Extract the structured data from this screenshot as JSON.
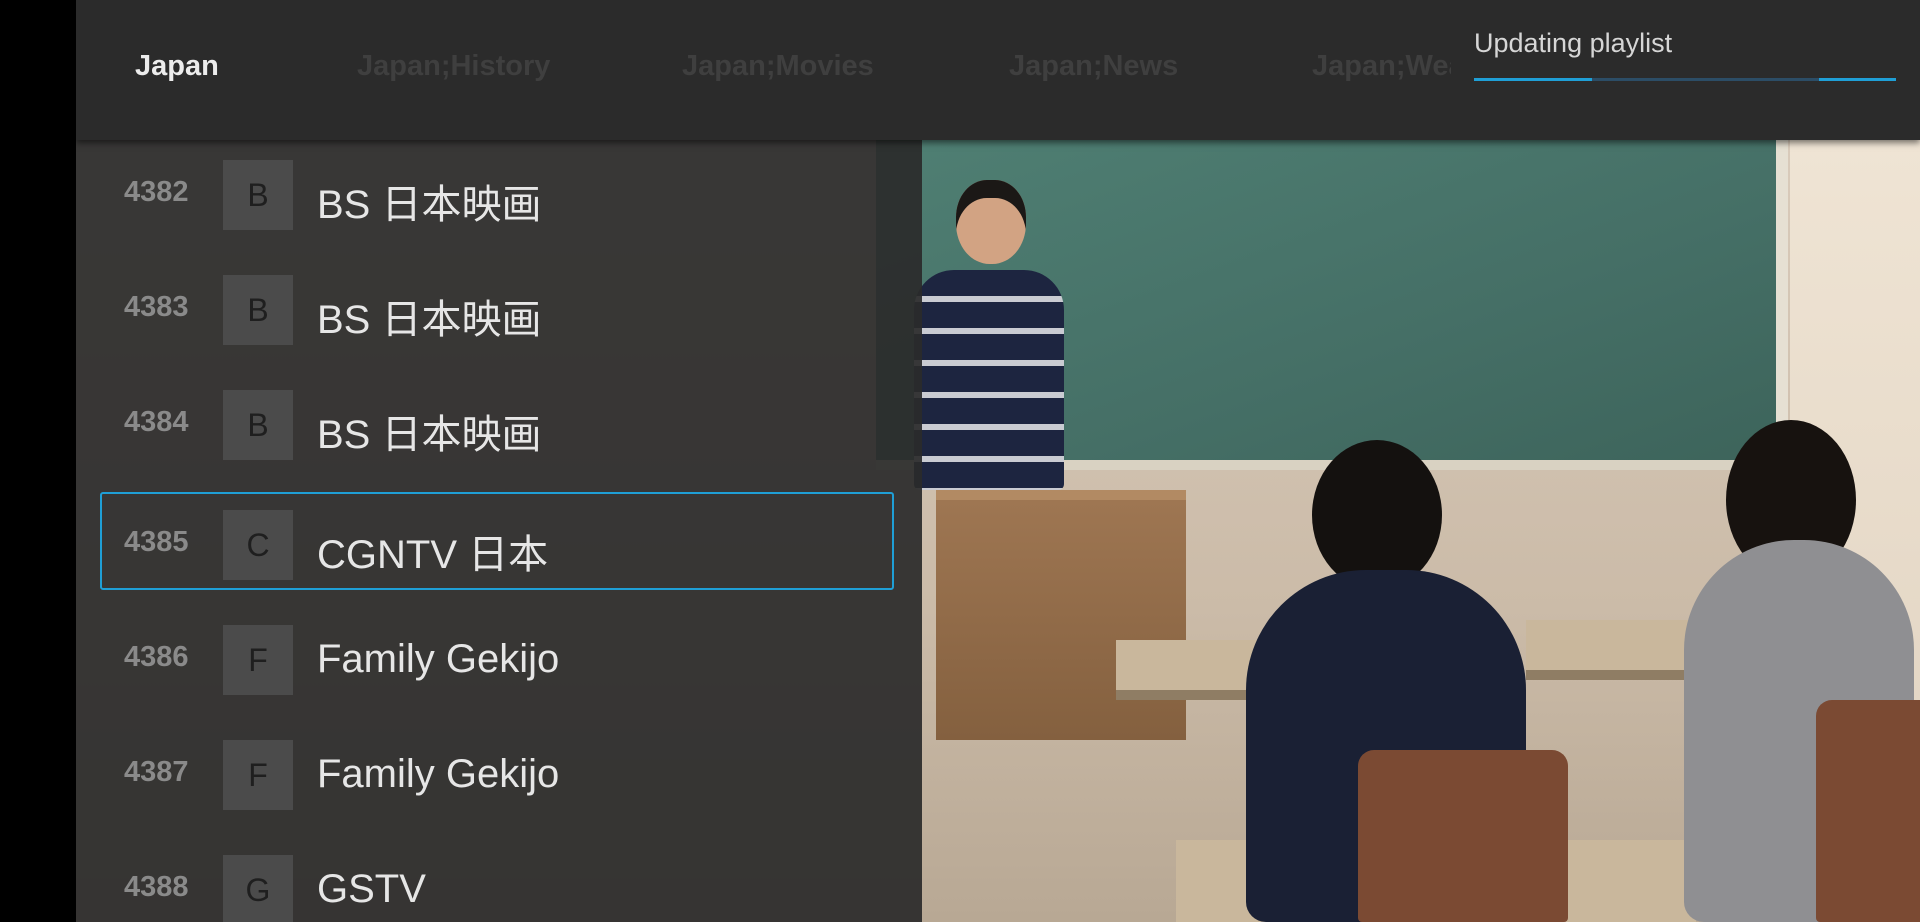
{
  "tabs": [
    {
      "label": "Japan",
      "active": true
    },
    {
      "label": "Japan;History",
      "active": false
    },
    {
      "label": "Japan;Movies",
      "active": false
    },
    {
      "label": "Japan;News",
      "active": false
    },
    {
      "label": "Japan;Wea",
      "active": false
    }
  ],
  "status": {
    "text": "Updating playlist"
  },
  "channels": [
    {
      "number": "4382",
      "letter": "B",
      "name": "BS 日本映画"
    },
    {
      "number": "4383",
      "letter": "B",
      "name": "BS 日本映画"
    },
    {
      "number": "4384",
      "letter": "B",
      "name": "BS 日本映画"
    },
    {
      "number": "4385",
      "letter": "C",
      "name": "CGNTV 日本",
      "selected": true
    },
    {
      "number": "4386",
      "letter": "F",
      "name": "Family Gekijo"
    },
    {
      "number": "4387",
      "letter": "F",
      "name": "Family Gekijo"
    },
    {
      "number": "4388",
      "letter": "G",
      "name": "GSTV"
    }
  ],
  "colors": {
    "accent": "#1f9fd6",
    "topbar": "#2b2b2b",
    "panel": "#2a2a2a"
  }
}
